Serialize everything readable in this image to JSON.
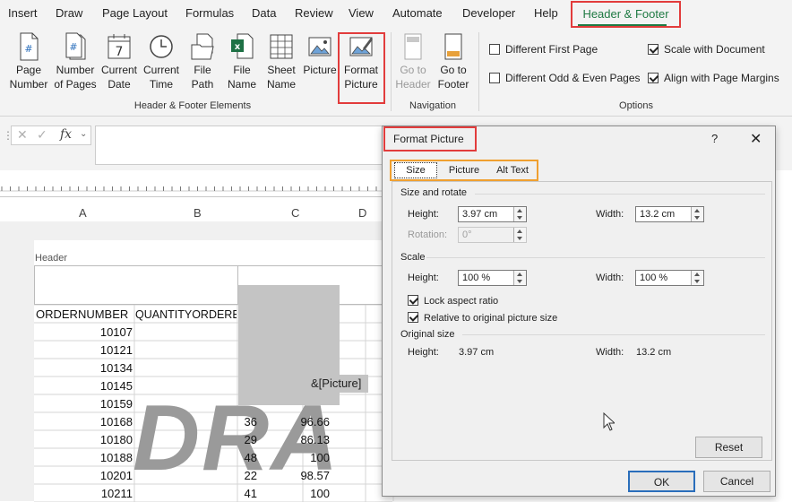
{
  "tabs": [
    "Insert",
    "Draw",
    "Page Layout",
    "Formulas",
    "Data",
    "Review",
    "View",
    "Automate",
    "Developer",
    "Help"
  ],
  "active_tab": "Header & Footer",
  "ribbon": {
    "hf_elements": [
      {
        "l1": "Page",
        "l2": "Number",
        "icon": "page-number-icon"
      },
      {
        "l1": "Number",
        "l2": "of Pages",
        "icon": "number-of-pages-icon"
      },
      {
        "l1": "Current",
        "l2": "Date",
        "icon": "calendar-icon"
      },
      {
        "l1": "Current",
        "l2": "Time",
        "icon": "clock-icon"
      },
      {
        "l1": "File",
        "l2": "Path",
        "icon": "folder-icon"
      },
      {
        "l1": "File",
        "l2": "Name",
        "icon": "excel-file-icon"
      },
      {
        "l1": "Sheet",
        "l2": "Name",
        "icon": "sheet-grid-icon"
      },
      {
        "l1": "Picture",
        "l2": "",
        "icon": "picture-icon"
      },
      {
        "l1": "Format",
        "l2": "Picture",
        "icon": "format-picture-icon"
      }
    ],
    "hf_group_label": "Header & Footer Elements",
    "navigation": [
      {
        "l1": "Go to",
        "l2": "Header"
      },
      {
        "l1": "Go to",
        "l2": "Footer"
      }
    ],
    "navigation_label": "Navigation",
    "options": {
      "different_first_page": "Different First Page",
      "different_odd_even": "Different Odd & Even Pages",
      "scale_with_document": "Scale with Document",
      "align_with_margins": "Align with Page Margins",
      "label": "Options"
    }
  },
  "formula_bar": {
    "fx": "fx"
  },
  "sheet": {
    "columns": [
      "A",
      "B",
      "C",
      "D"
    ],
    "header_label": "Header",
    "col_headers": [
      "ORDERNUMBER",
      "QUANTITYORDERED"
    ],
    "picture_code": "&[Picture]",
    "watermark": "DRA",
    "order_numbers": [
      "10107",
      "10121",
      "10134",
      "10145",
      "10159",
      "10168",
      "10180",
      "10188",
      "10201",
      "10211"
    ],
    "rows_cd": [
      {
        "q": "36",
        "p": "96.66"
      },
      {
        "q": "29",
        "p": "86.13"
      },
      {
        "q": "48",
        "p": "100"
      },
      {
        "q": "22",
        "p": "98.57"
      },
      {
        "q": "41",
        "p": "100"
      }
    ]
  },
  "dialog": {
    "title": "Format Picture",
    "help": "?",
    "close": "✕",
    "tabs": [
      "Size",
      "Picture",
      "Alt Text"
    ],
    "size_rotate": "Size and rotate",
    "height_label": "Height:",
    "width_label": "Width:",
    "rotation_label": "Rotation:",
    "height_val": "3.97 cm",
    "width_val": "13.2 cm",
    "rotation_val": "0°",
    "scale": "Scale",
    "scale_height": "100 %",
    "scale_width": "100 %",
    "lock_aspect": "Lock aspect ratio",
    "relative": "Relative to original picture size",
    "original_size": "Original size",
    "orig_height": "3.97 cm",
    "orig_width": "13.2 cm",
    "reset": "Reset",
    "ok": "OK",
    "cancel": "Cancel"
  }
}
